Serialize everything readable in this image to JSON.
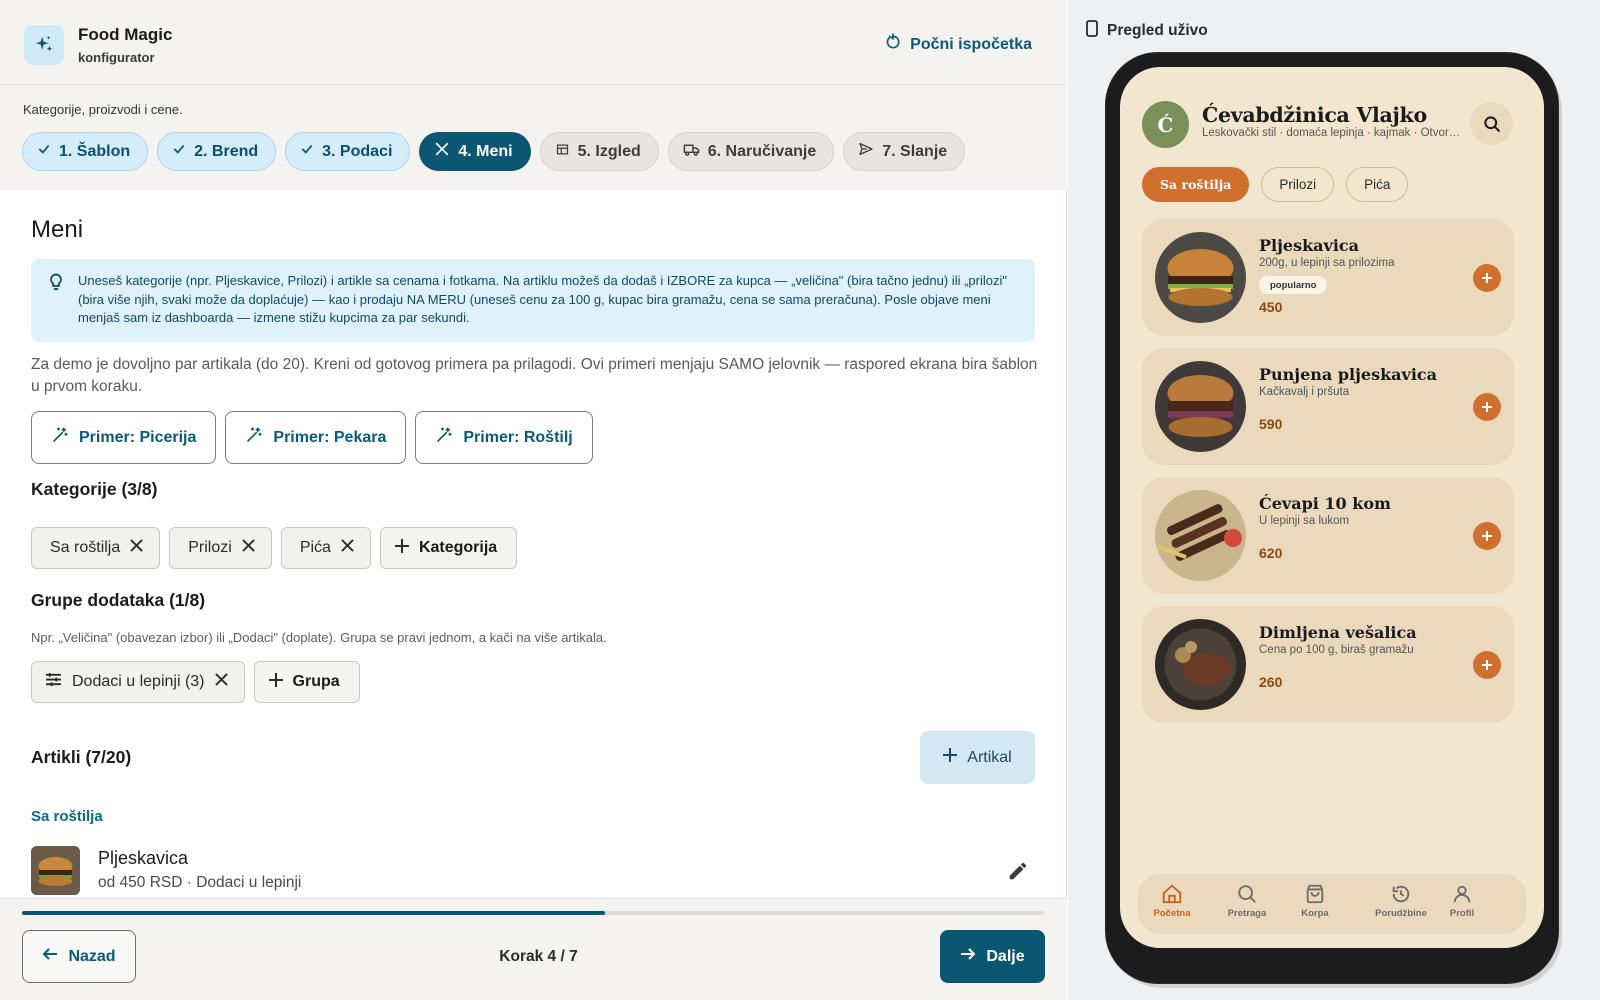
{
  "app": {
    "title": "Food Magic",
    "subtitle": "konfigurator",
    "restart_label": "Počni ispočetka"
  },
  "steps": {
    "caption": "Kategorije, proizvodi i cene.",
    "items": [
      {
        "label": "1. Šablon",
        "state": "done"
      },
      {
        "label": "2. Brend",
        "state": "done"
      },
      {
        "label": "3. Podaci",
        "state": "done"
      },
      {
        "label": "4. Meni",
        "state": "active"
      },
      {
        "label": "5. Izgled",
        "state": "todo"
      },
      {
        "label": "6. Naručivanje",
        "state": "todo"
      },
      {
        "label": "7. Slanje",
        "state": "todo"
      }
    ]
  },
  "main": {
    "heading": "Meni",
    "info": "Uneseš kategorije (npr. Pljeskavice, Prilozi) i artikle sa cenama i fotkama. Na artiklu možeš da dodaš i IZBORE za kupca — „veličina\" (bira tačno jednu) ili „prilozi\" (bira više njih, svaki može da doplaćuje) — kao i prodaju NA MERU (uneseš cenu za 100 g, kupac bira gramažu, cena se sama preračuna). Posle objave meni menjaš sam iz dashboarda — izmene stižu kupcima za par sekundi.",
    "demo_text": "Za demo je dovoljno par artikala (do 20). Kreni od gotovog primera pa prilagodi. Ovi primeri menjaju SAMO jelovnik — raspored ekrana bira šablon u prvom koraku.",
    "examples": [
      "Primer: Picerija",
      "Primer: Pekara",
      "Primer: Roštilj"
    ],
    "categories_title": "Kategorije (3/8)",
    "categories": [
      "Sa roštilja",
      "Prilozi",
      "Pića"
    ],
    "add_category": "Kategorija",
    "groups_title": "Grupe dodataka (1/8)",
    "groups_note": "Npr. „Veličina\" (obavezan izbor) ili „Dodaci\" (doplate). Grupa se pravi jednom, a kači na više artikala.",
    "groups": [
      "Dodaci u lepinji (3)"
    ],
    "add_group": "Grupa",
    "items_title": "Artikli (7/20)",
    "add_item": "Artikal",
    "item_category": "Sa roštilja",
    "first_item": {
      "name": "Pljeskavica",
      "sub": "od 450 RSD · Dodaci u lepinji"
    }
  },
  "footer": {
    "back_label": "Nazad",
    "step_text": "Korak 4 / 7",
    "next_label": "Dalje",
    "progress": 0.57
  },
  "preview": {
    "label": "Pregled uživo",
    "logo_letter": "Ć",
    "restaurant_name": "Ćevabdžinica Vlajko",
    "tagline": "Leskovački stil · domaća lepinja · kajmak · Otvoreno",
    "tabs": [
      "Sa roštilja",
      "Prilozi",
      "Pića"
    ],
    "cards": [
      {
        "name": "Pljeskavica",
        "desc": "200g, u lepinji sa prilozima",
        "badge": "popularno",
        "price": "450"
      },
      {
        "name": "Punjena pljeskavica",
        "desc": "Kačkavalj i pršuta",
        "badge": "",
        "price": "590"
      },
      {
        "name": "Ćevapi 10 kom",
        "desc": "U lepinji sa lukom",
        "badge": "",
        "price": "620"
      },
      {
        "name": "Dimljena vešalica",
        "desc": "Cena po 100 g, biraš gramažu",
        "badge": "",
        "price": "260"
      }
    ],
    "nav": [
      "Početna",
      "Pretraga",
      "Korpa",
      "Porudžbine",
      "Profil"
    ]
  },
  "colors": {
    "primary": "#0b5672",
    "accent_orange": "#d0702f",
    "screen_bg": "#f3e6cf",
    "card_bg": "#ead9bd",
    "info_bg": "#dff2fb"
  }
}
